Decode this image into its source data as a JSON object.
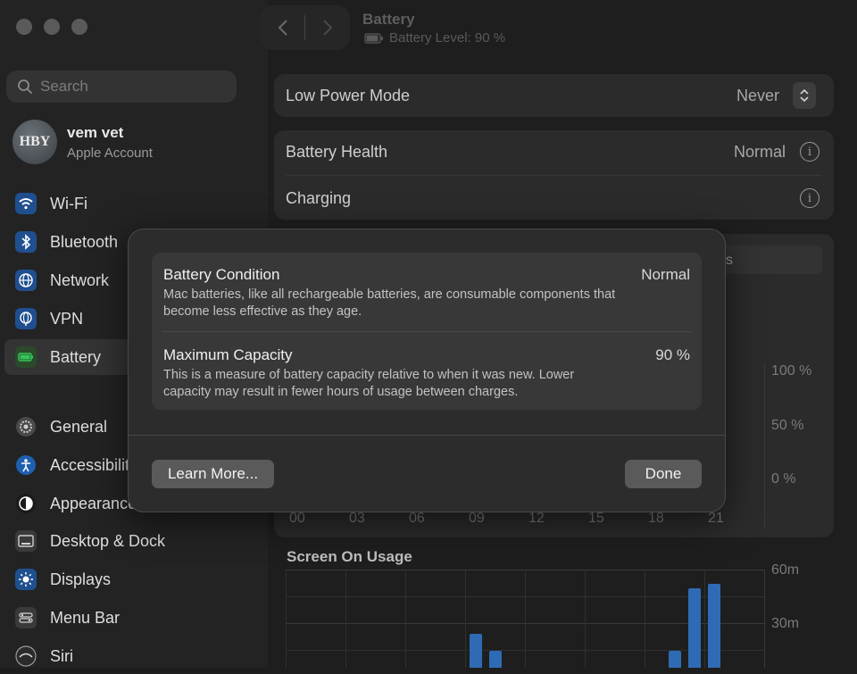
{
  "window": {
    "title": "Battery",
    "subtitle": "Battery Level: 90 %"
  },
  "sidebar": {
    "search": {
      "placeholder": "Search"
    },
    "account": {
      "initials": "HBY",
      "name": "vem vet",
      "subtitle": "Apple Account"
    },
    "items": [
      {
        "label": "Wi-Fi",
        "icon": "wifi-icon"
      },
      {
        "label": "Bluetooth",
        "icon": "bluetooth-icon"
      },
      {
        "label": "Network",
        "icon": "globe-icon"
      },
      {
        "label": "VPN",
        "icon": "vpn-globe-icon"
      },
      {
        "label": "Battery",
        "icon": "battery-icon",
        "active": true
      },
      {
        "label": "General",
        "icon": "gear-icon"
      },
      {
        "label": "Accessibility",
        "icon": "accessibility-icon"
      },
      {
        "label": "Appearance",
        "icon": "appearance-icon"
      },
      {
        "label": "Desktop & Dock",
        "icon": "desktop-dock-icon"
      },
      {
        "label": "Displays",
        "icon": "sun-icon"
      },
      {
        "label": "Menu Bar",
        "icon": "menu-bar-icon"
      },
      {
        "label": "Siri",
        "icon": "siri-icon"
      }
    ]
  },
  "main": {
    "low_power": {
      "label": "Low Power Mode",
      "value": "Never"
    },
    "battery_health": {
      "label": "Battery Health",
      "value": "Normal"
    },
    "charging": {
      "label": "Charging"
    },
    "partial_tab_text": "s",
    "battery_chart": {
      "y_ticks": [
        "100 %",
        "50 %",
        "0 %"
      ],
      "x_ticks": [
        "00",
        "03",
        "06",
        "09",
        "12",
        "15",
        "18",
        "21"
      ]
    },
    "screen_on": {
      "title": "Screen On Usage",
      "y_ticks": [
        "60m",
        "30m"
      ]
    }
  },
  "modal": {
    "battery_condition": {
      "title": "Battery Condition",
      "value": "Normal",
      "description": "Mac batteries, like all rechargeable batteries, are consumable components that become less effective as they age."
    },
    "maximum_capacity": {
      "title": "Maximum Capacity",
      "value": "90 %",
      "description": "This is a measure of battery capacity relative to when it was new. Lower capacity may result in fewer hours of usage between charges."
    },
    "learn_more_label": "Learn More...",
    "done_label": "Done"
  },
  "colors": {
    "accent_blue": "#2f6bb5",
    "battery_green": "#34c759"
  }
}
